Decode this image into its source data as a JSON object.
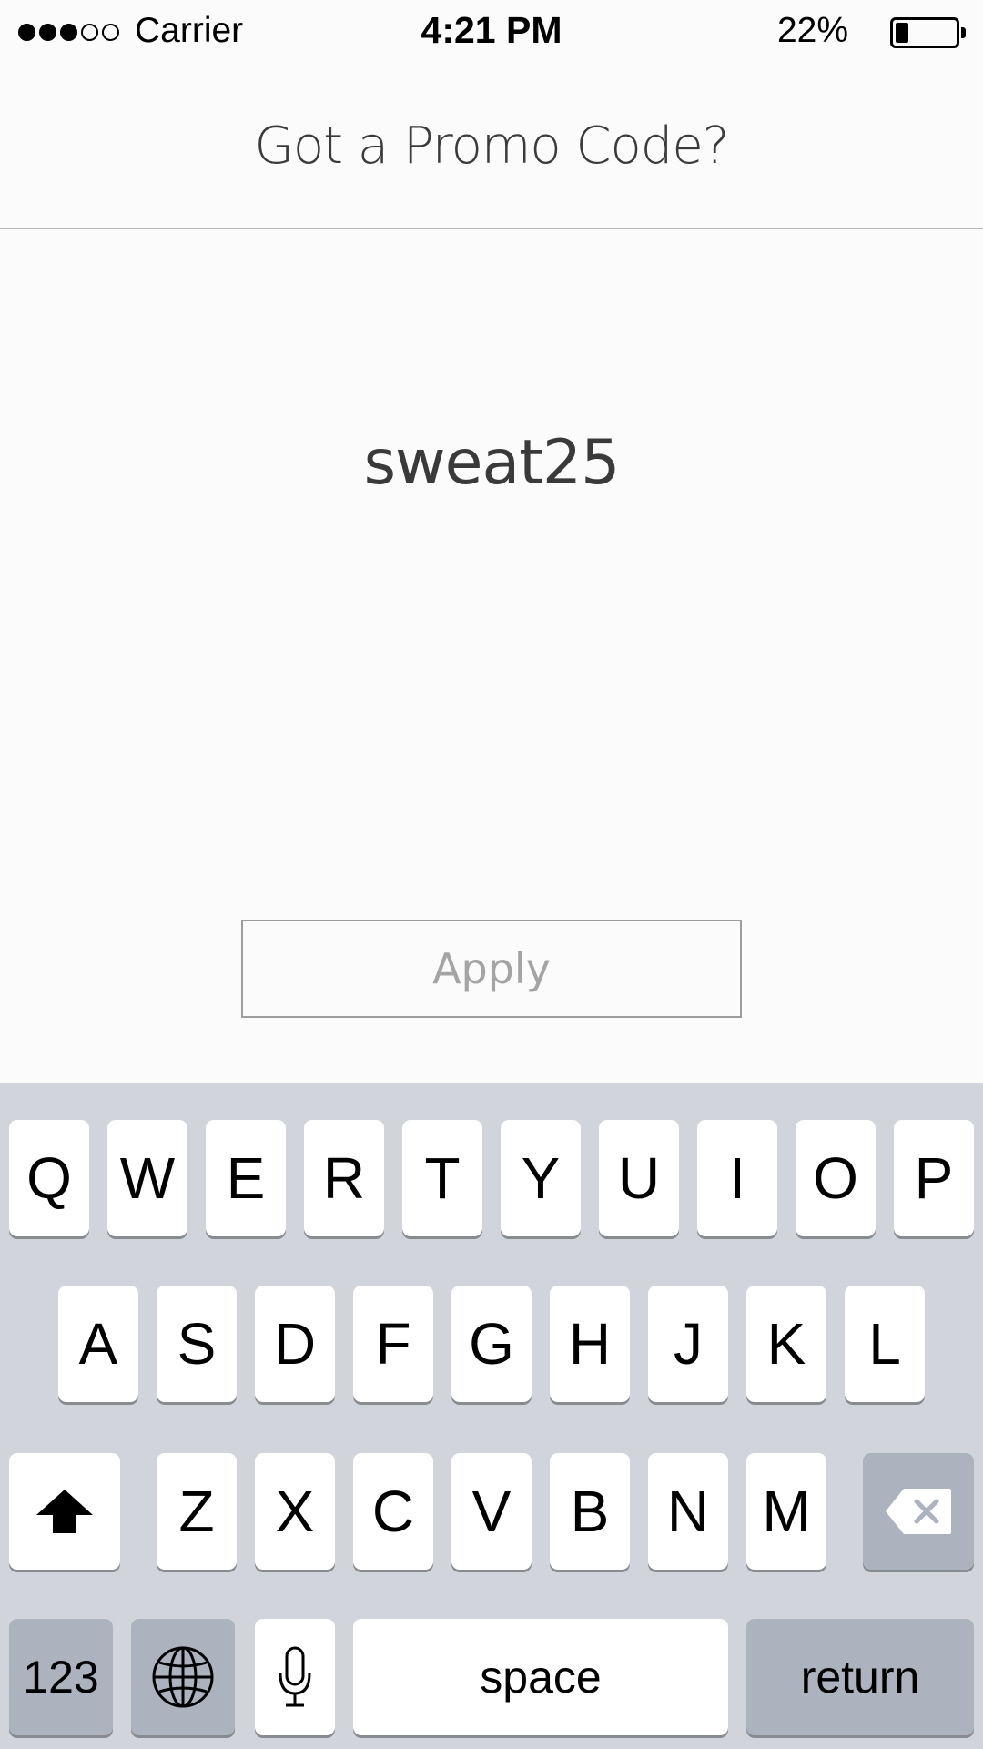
{
  "status_bar": {
    "carrier": "Carrier",
    "time": "4:21 PM",
    "battery_percent": "22%",
    "battery_level": 0.22,
    "signal_bars": 3,
    "signal_total": 5
  },
  "header": {
    "title": "Got a Promo Code?"
  },
  "promo": {
    "code_value": "sweat25",
    "apply_label": "Apply"
  },
  "keyboard": {
    "row1": [
      "Q",
      "W",
      "E",
      "R",
      "T",
      "Y",
      "U",
      "I",
      "O",
      "P"
    ],
    "row2": [
      "A",
      "S",
      "D",
      "F",
      "G",
      "H",
      "J",
      "K",
      "L"
    ],
    "row3": [
      "Z",
      "X",
      "C",
      "V",
      "B",
      "N",
      "M"
    ],
    "numbers_label": "123",
    "space_label": "space",
    "return_label": "return",
    "icons": [
      "shift-icon",
      "backspace-icon",
      "globe-icon",
      "microphone-icon"
    ]
  },
  "colors": {
    "background": "#fcfbfb",
    "keyboard_bg": "#d1d5db",
    "dark_key": "#acb3bf",
    "title_text": "#3b3b3b",
    "apply_text": "#a4a4a4"
  }
}
